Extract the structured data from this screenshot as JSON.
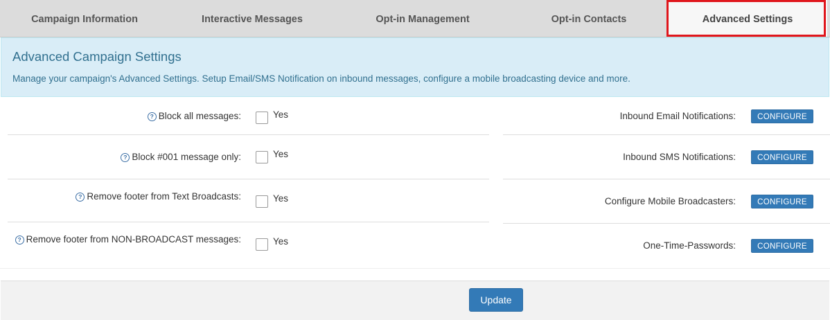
{
  "tabs": [
    {
      "label": "Campaign Information"
    },
    {
      "label": "Interactive Messages"
    },
    {
      "label": "Opt-in Management"
    },
    {
      "label": "Opt-in Contacts"
    },
    {
      "label": "Advanced Settings",
      "active": true
    }
  ],
  "panel": {
    "title": "Advanced Campaign Settings",
    "description": "Manage your campaign's Advanced Settings. Setup Email/SMS Notification on inbound messages, configure a mobile broadcasting device and more."
  },
  "left_options": [
    {
      "label": "Block all messages:",
      "checkbox_text": "Yes",
      "checked": false
    },
    {
      "label": "Block #001 message only:",
      "checkbox_text": "Yes",
      "checked": false
    },
    {
      "label": "Remove footer from Text Broadcasts:",
      "checkbox_text": "Yes",
      "checked": false
    },
    {
      "label": "Remove footer from NON-BROADCAST messages:",
      "checkbox_text": "Yes",
      "checked": false
    }
  ],
  "right_options": [
    {
      "label": "Inbound Email Notifications:",
      "button": "CONFIGURE"
    },
    {
      "label": "Inbound SMS Notifications:",
      "button": "CONFIGURE"
    },
    {
      "label": "Configure Mobile Broadcasters:",
      "button": "CONFIGURE"
    },
    {
      "label": "One-Time-Passwords:",
      "button": "CONFIGURE"
    }
  ],
  "help_icon": "?",
  "footer": {
    "update_label": "Update"
  },
  "colors": {
    "accent": "#337ab7",
    "info_bg": "#d9edf7",
    "info_text": "#31708f",
    "highlight": "#e0161c"
  }
}
